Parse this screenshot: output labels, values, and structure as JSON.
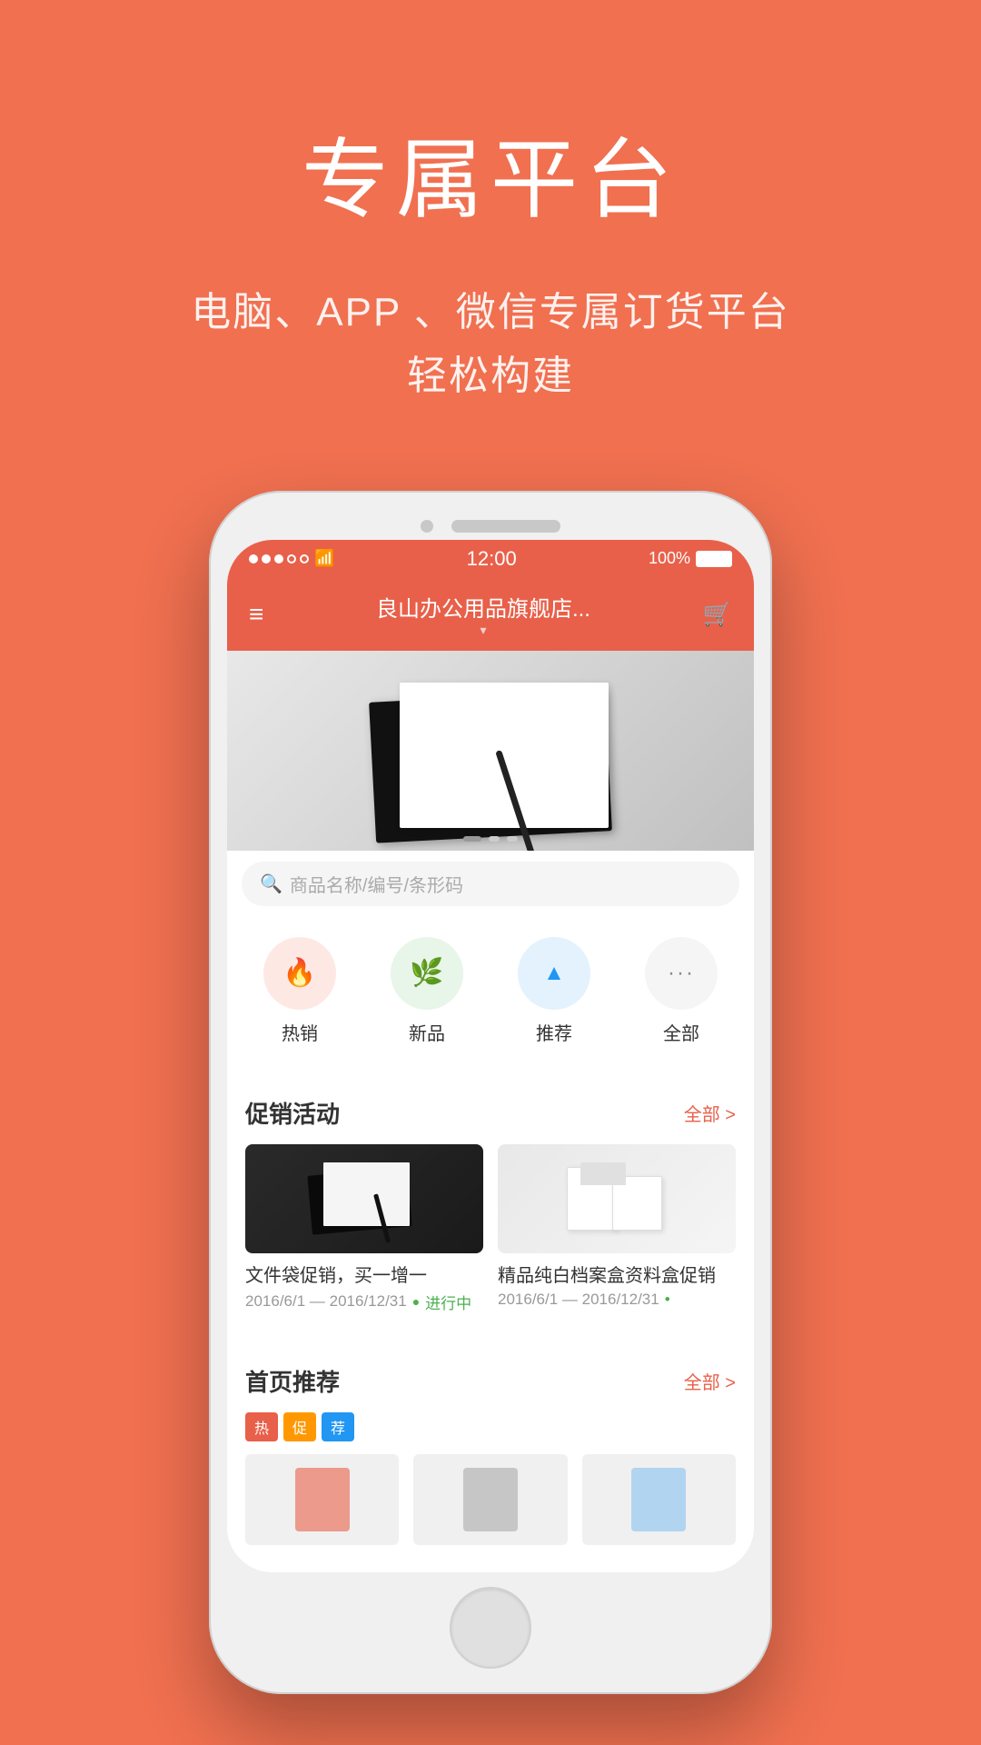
{
  "page": {
    "background_color": "#F07050"
  },
  "header": {
    "main_title": "专属平台",
    "sub_line1": "电脑、APP 、微信专属订货平台",
    "sub_line2": "轻松构建"
  },
  "status_bar": {
    "time": "12:00",
    "battery": "100%",
    "signal": "●●●○○",
    "wifi": "wifi"
  },
  "app_header": {
    "menu_icon": "☰",
    "title": "良山办公用品旗舰店...",
    "cart_icon": "🛒",
    "dropdown_arrow": "▾"
  },
  "search": {
    "placeholder": "商品名称/编号/条形码"
  },
  "categories": [
    {
      "id": "hot",
      "label": "热销",
      "icon": "🔥",
      "style": "hot"
    },
    {
      "id": "new",
      "label": "新品",
      "icon": "🌿",
      "style": "new"
    },
    {
      "id": "rec",
      "label": "推荐",
      "icon": "▲",
      "style": "rec"
    },
    {
      "id": "all",
      "label": "全部",
      "icon": "···",
      "style": "all"
    }
  ],
  "promotions": {
    "section_title": "促销活动",
    "more_label": "全部 >",
    "items": [
      {
        "title": "文件袋促销，买一增一",
        "date": "2016/6/1 — 2016/12/31",
        "status": "进行中",
        "type": "dark"
      },
      {
        "title": "精品纯白档案盒资料盒促销",
        "date": "2016/6/1 — 2016/12/31",
        "status": "•",
        "type": "light"
      }
    ]
  },
  "featured": {
    "section_title": "首页推荐",
    "more_label": "全部 >",
    "tags": [
      "热",
      "促",
      "荐"
    ]
  }
}
